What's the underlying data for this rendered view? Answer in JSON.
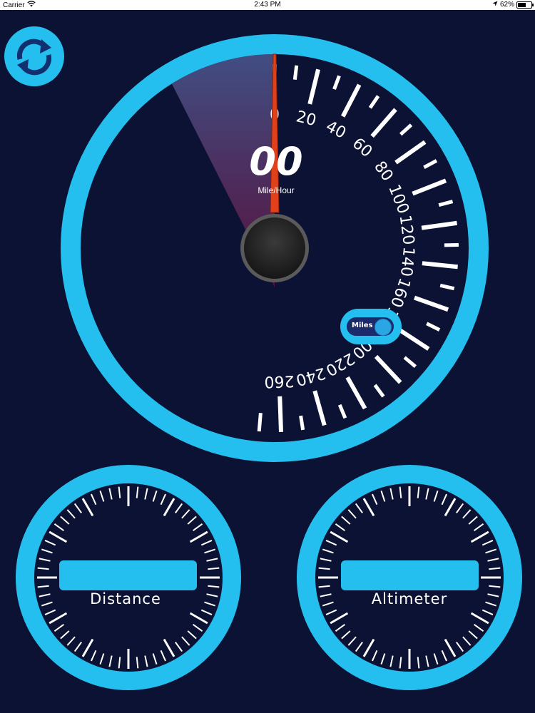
{
  "status_bar": {
    "carrier": "Carrier",
    "time": "2:43 PM",
    "battery": "62%",
    "battery_level": 0.62
  },
  "speedometer": {
    "readout": "00",
    "unit": "Mile/Hour",
    "scale_min": 0,
    "scale_max": 260,
    "scale_labels": [
      "0",
      "20",
      "40",
      "60",
      "80",
      "100",
      "120",
      "140",
      "160",
      "180",
      "200",
      "220",
      "240",
      "260"
    ],
    "needle_value": 0
  },
  "unit_toggle": {
    "label": "Miles"
  },
  "gauges": {
    "distance_label": "Distance",
    "altimeter_label": "Altimeter"
  },
  "colors": {
    "background": "#0c1233",
    "accent": "#24bfee",
    "needle": "#e0401a",
    "tick": "#ffffff"
  },
  "icons": {
    "refresh": "refresh-icon",
    "wifi": "wifi-icon",
    "location": "location-arrow-icon",
    "battery": "battery-icon"
  }
}
